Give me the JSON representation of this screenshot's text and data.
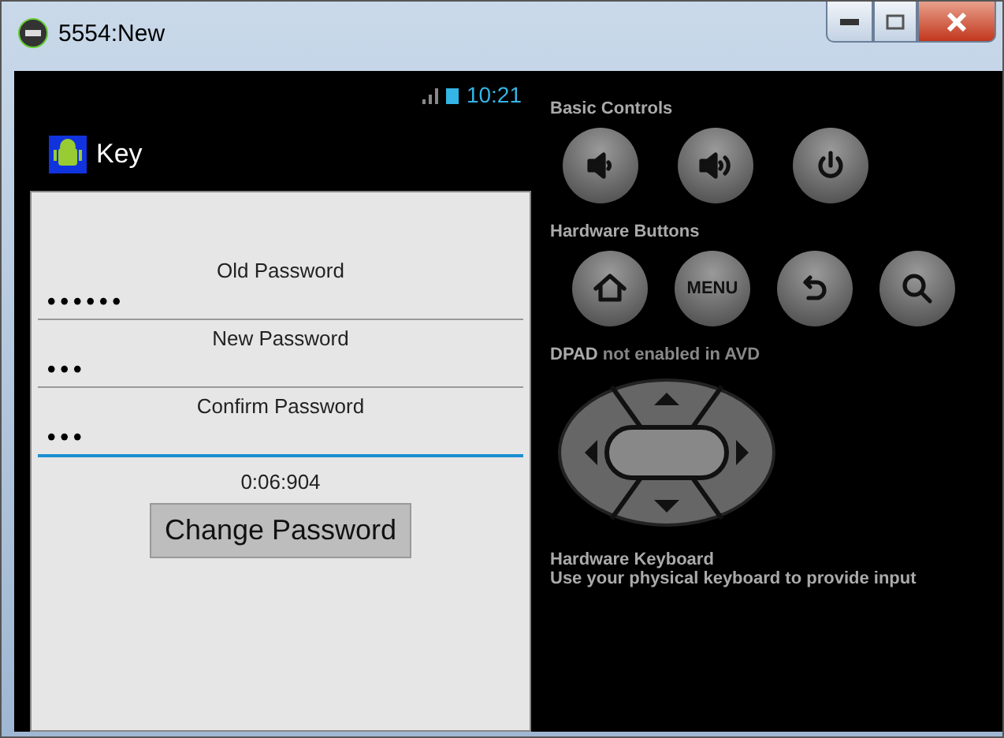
{
  "window": {
    "title": "5554:New"
  },
  "status_bar": {
    "time": "10:21"
  },
  "action_bar": {
    "title": "Key"
  },
  "form": {
    "fields": [
      {
        "label": "Old Password",
        "value": "••••••",
        "focused": false
      },
      {
        "label": "New Password",
        "value": "•••",
        "focused": false
      },
      {
        "label": "Confirm Password",
        "value": "•••",
        "focused": true
      }
    ],
    "timer": "0:06:904",
    "button": "Change Password"
  },
  "controls": {
    "basic_title": "Basic Controls",
    "basic": [
      {
        "kind": "volume-down"
      },
      {
        "kind": "volume-up"
      },
      {
        "kind": "power"
      }
    ],
    "hardware_title": "Hardware Buttons",
    "hardware": [
      {
        "kind": "home"
      },
      {
        "kind": "menu",
        "label": "MENU"
      },
      {
        "kind": "back"
      },
      {
        "kind": "search"
      }
    ],
    "dpad_note": "**DPAD** not enabled in AVD",
    "keyboard_title": "Hardware Keyboard",
    "keyboard_note": "Use your physical keyboard to provide input"
  }
}
